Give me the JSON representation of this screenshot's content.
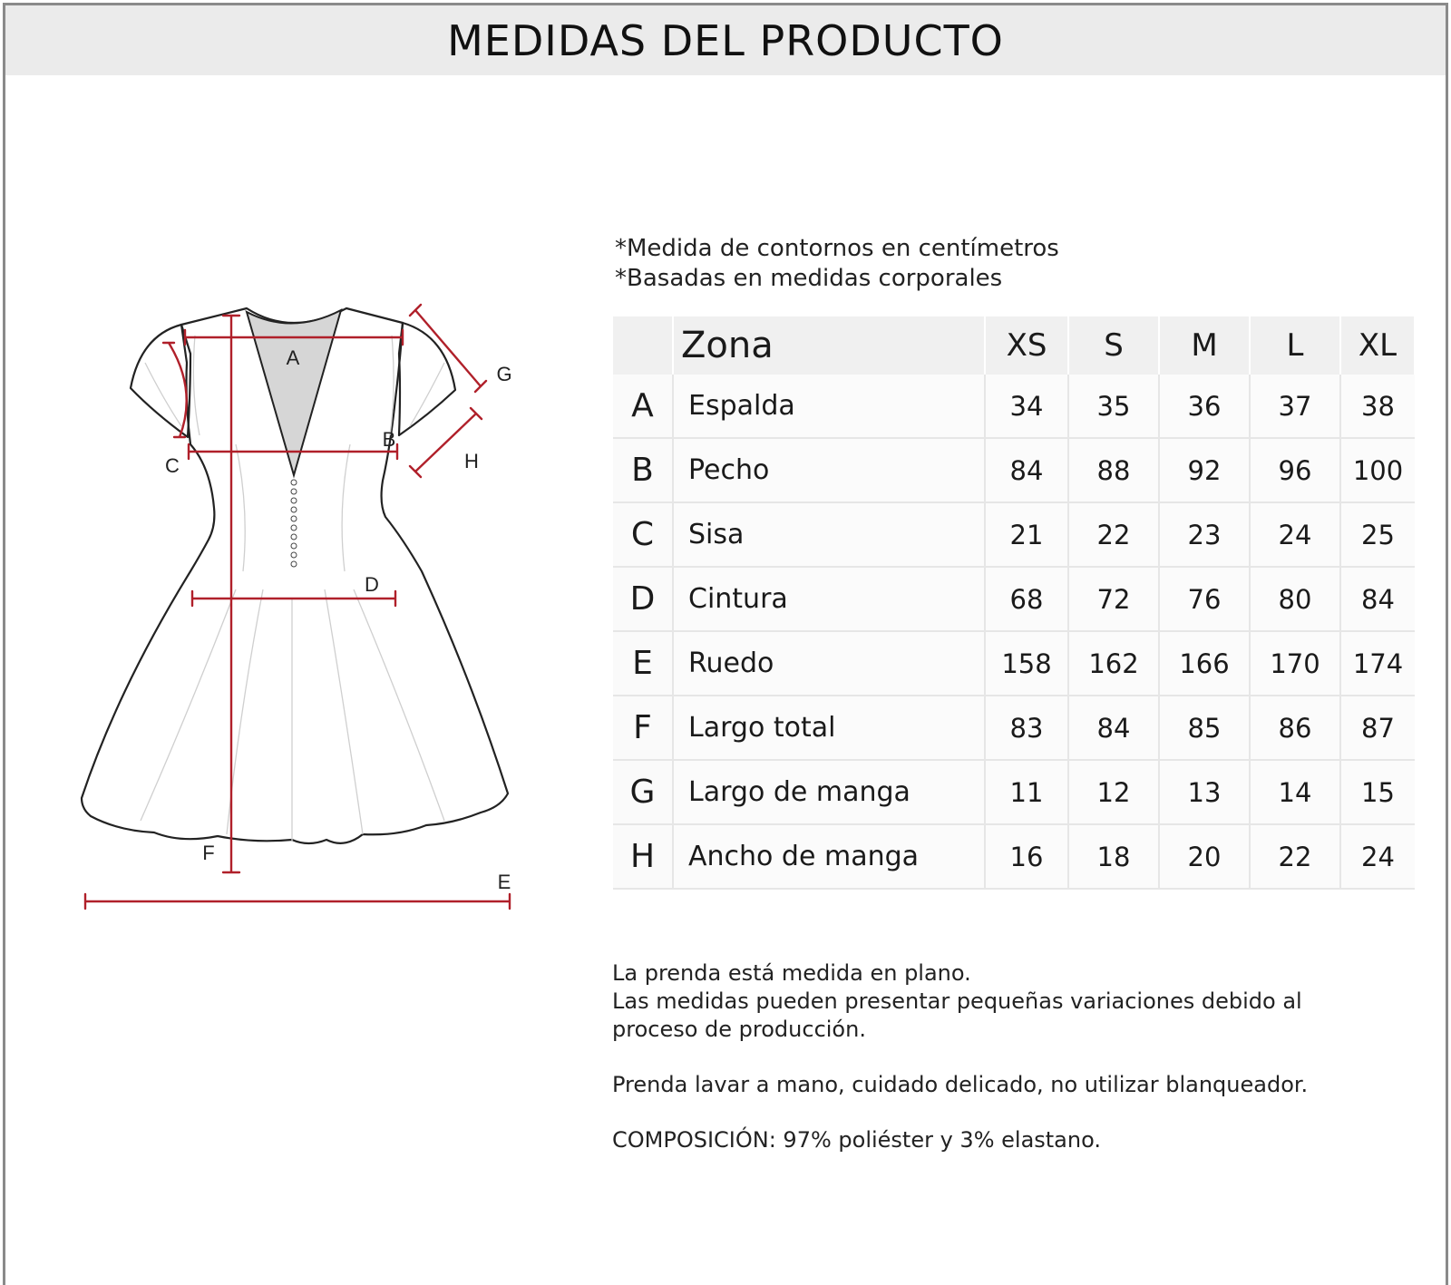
{
  "header": {
    "title": "MEDIDAS DEL PRODUCTO"
  },
  "notes": [
    "*Medida de contornos en centímetros",
    "*Basadas en medidas corporales"
  ],
  "diagram": {
    "labels": {
      "A": "A",
      "B": "B",
      "C": "C",
      "D": "D",
      "E": "E",
      "F": "F",
      "G": "G",
      "H": "H"
    },
    "measure_color": "#b0202a"
  },
  "table": {
    "zone_header": "Zona",
    "sizes": [
      "XS",
      "S",
      "M",
      "L",
      "XL"
    ],
    "rows": [
      {
        "code": "A",
        "zone": "Espalda",
        "values": [
          "34",
          "35",
          "36",
          "37",
          "38"
        ]
      },
      {
        "code": "B",
        "zone": "Pecho",
        "values": [
          "84",
          "88",
          "92",
          "96",
          "100"
        ]
      },
      {
        "code": "C",
        "zone": "Sisa",
        "values": [
          "21",
          "22",
          "23",
          "24",
          "25"
        ]
      },
      {
        "code": "D",
        "zone": "Cintura",
        "values": [
          "68",
          "72",
          "76",
          "80",
          "84"
        ]
      },
      {
        "code": "E",
        "zone": "Ruedo",
        "values": [
          "158",
          "162",
          "166",
          "170",
          "174"
        ]
      },
      {
        "code": "F",
        "zone": "Largo total",
        "values": [
          "83",
          "84",
          "85",
          "86",
          "87"
        ]
      },
      {
        "code": "G",
        "zone": "Largo de manga",
        "values": [
          "11",
          "12",
          "13",
          "14",
          "15"
        ]
      },
      {
        "code": "H",
        "zone": "Ancho de manga",
        "values": [
          "16",
          "18",
          "20",
          "22",
          "24"
        ]
      }
    ]
  },
  "info": {
    "line1": "La prenda está medida en plano.",
    "line2": "Las medidas pueden presentar pequeñas variaciones debido al",
    "line3": "proceso de producción.",
    "care": "Prenda lavar a mano, cuidado delicado, no utilizar blanqueador.",
    "composition": "COMPOSICIÓN:  97% poliéster y 3% elastano."
  }
}
